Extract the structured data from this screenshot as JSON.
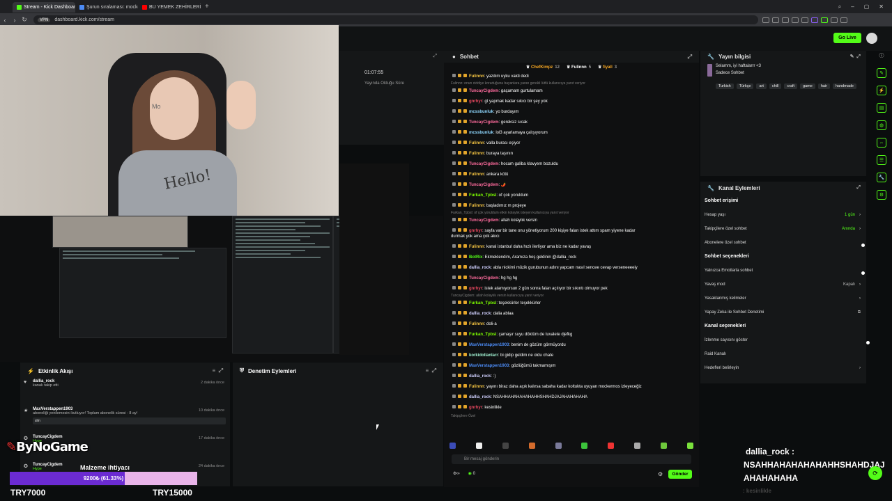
{
  "browser": {
    "tabs": [
      {
        "title": "Stream - Kick Dashboard",
        "color": "#53fc18",
        "active": true
      },
      {
        "title": "Şurun sıralaması: mocker...",
        "color": "#4c8bf5",
        "active": false
      },
      {
        "title": "BU YEMEK ZEHİRLERİ EFİ",
        "color": "#ff0000",
        "active": false
      }
    ],
    "vpn": "VPN",
    "url": "dashboard.kick.com/stream"
  },
  "header": {
    "go_live": "Go Live"
  },
  "stream_stats": {
    "time": "01:07:55",
    "label": "Yayında Olduğu Süre"
  },
  "webcam": {
    "shirt_text": "Hello!",
    "wall_text": "Mo"
  },
  "activity": {
    "title": "Etkinlik Akışı",
    "events": [
      {
        "icon": "heart-icon",
        "name": "dallia_rock",
        "sub": "kanalı takip etti",
        "when": "2 dakika önce",
        "box": ""
      },
      {
        "icon": "star-icon",
        "name": "MaxVerstappen1903",
        "sub": "aboneliği yenilemesini kutluyor! Toplam abonelik süresi - 8 ay!",
        "when": "10 dakika önce",
        "box": "slm"
      },
      {
        "icon": "gift-icon",
        "name": "TuncayCigdem",
        "sub": "Hype",
        "when": "17 dakika önce",
        "box": ""
      },
      {
        "icon": "gift-icon",
        "name": "TuncayCigdem",
        "sub": "Hype",
        "when": "24 dakika önce",
        "box": ""
      }
    ]
  },
  "moderation": {
    "title": "Denetim Eylemleri"
  },
  "chat": {
    "title": "Sohbet",
    "pinned": [
      {
        "name": "ChefKimpz",
        "count": "12",
        "color": "#f5a623"
      },
      {
        "name": "Fulinnn",
        "count": "5",
        "color": "#ffffff"
      },
      {
        "name": "fiyall",
        "count": "3",
        "color": "#f5a623"
      }
    ],
    "messages": [
      {
        "type": "msg",
        "user": "Fulinnn",
        "color": "#f5c542",
        "text": ": yazdım uyku vakti dedi"
      },
      {
        "type": "sys",
        "text": "Fulinnn: onun ciddiye koruduğuna bayanlara yaran gerekli lütfü kullanıcıya yanıt veriyor"
      },
      {
        "type": "msg",
        "user": "TuncayCigdem",
        "color": "#ff6b9d",
        "text": ": gaçamam gurtulamam"
      },
      {
        "type": "msg",
        "user": "gnrhyr",
        "color": "#e8475f",
        "text": ": gt yapmak kadar sıkıcı bir şey yok"
      },
      {
        "type": "msg",
        "user": "mcssbunluk",
        "color": "#8fd8ff",
        "text": ": yo burdayım"
      },
      {
        "type": "msg",
        "user": "TuncayCigdem",
        "color": "#ff6b9d",
        "text": ": gereksiz sıcak"
      },
      {
        "type": "msg",
        "user": "mcssbunluk",
        "color": "#8fd8ff",
        "text": ": lol3 ayarlamaya çalışıyorum"
      },
      {
        "type": "msg",
        "user": "Fulinnn",
        "color": "#f5c542",
        "text": ": valla burası eşiyor"
      },
      {
        "type": "msg",
        "user": "Fulinnn",
        "color": "#f5c542",
        "text": ": buraya taşının"
      },
      {
        "type": "msg",
        "user": "TuncayCigdem",
        "color": "#ff6b9d",
        "text": ": hocam galiba klavyem bozuldu"
      },
      {
        "type": "msg",
        "user": "Fulinnn",
        "color": "#f5c542",
        "text": ": ankara kötü"
      },
      {
        "type": "msg",
        "user": "TuncayCigdem",
        "color": "#ff6b9d",
        "text": ": 🌶️"
      },
      {
        "type": "msg",
        "user": "Furkan_Tpbsl",
        "color": "#7cfc00",
        "text": ": of çok yoruldum"
      },
      {
        "type": "msg",
        "user": "Fulinnn",
        "color": "#f5c542",
        "text": ": başladımız m projeye"
      },
      {
        "type": "sys",
        "text": "Furkan_Tpbsl: of çok yoruldum etkin kolaylık isteyen kullanıcıya yanıt veriyor"
      },
      {
        "type": "msg",
        "user": "TuncayCigdem",
        "color": "#ff6b9d",
        "text": ": allah kolaylık versin"
      },
      {
        "type": "msg2",
        "user": "gnrhyr",
        "color": "#e8475f",
        "text": ": sayfa var bir tane onu yönetiyorum 200 kişiye falan istek attım spam yiyene kadar",
        "text2": "durmak yok ama çok akıcı"
      },
      {
        "type": "msg",
        "user": "Fulinnn",
        "color": "#f5c542",
        "text": ": kanal istanbul daha hızlı ilerliyor ama biz ne kadar yavaş"
      },
      {
        "type": "msg",
        "user": "BotRix",
        "color": "#53fc18",
        "text": ": Ekmeklendim, Aramıza hoş geldinin @dallia_rock"
      },
      {
        "type": "msg",
        "user": "dallia_rock",
        "color": "#d0d0ff",
        "text": ": abla nickimi müzik gurubunun adını yapcam nasıl sencee cevap verseneeeeiy"
      },
      {
        "type": "msg",
        "user": "TuncayCigdem",
        "color": "#ff6b9d",
        "text": ": hg hg hg"
      },
      {
        "type": "msg",
        "user": "gnrhyr",
        "color": "#e8475f",
        "text": ": istek atamıyorsun 2 gün sonra falan açılıyor bir sıkıntı olmuyor pek"
      },
      {
        "type": "sys",
        "text": "TuncayCigdem: allah kolaylık versin kullanıcıya yanıt veriyor"
      },
      {
        "type": "msg",
        "user": "Furkan_Tpbsl",
        "color": "#7cfc00",
        "text": ": teşekkürler teşekkürler"
      },
      {
        "type": "msg",
        "user": "dallia_rock",
        "color": "#d0d0ff",
        "text": ": dalia ablaa"
      },
      {
        "type": "msg",
        "user": "Fulinnn",
        "color": "#f5c542",
        "text": ": doli-a"
      },
      {
        "type": "msg",
        "user": "Furkan_Tpbsl",
        "color": "#7cfc00",
        "text": ": çamaşır suyu döktüm de tuvalete djefkg"
      },
      {
        "type": "msg",
        "user": "MaxVerstappen1903",
        "color": "#4c8bf5",
        "text": ": benim de gözüm görmüyordu"
      },
      {
        "type": "msg",
        "user": "korkidollanlarr",
        "color": "#a0f0d0",
        "text": ": bi gidip geldim ne oldu chate"
      },
      {
        "type": "msg",
        "user": "MaxVerstappen1903",
        "color": "#4c8bf5",
        "text": ": gözlüğümü takmamışım"
      },
      {
        "type": "msg",
        "user": "dallia_rock",
        "color": "#d0d0ff",
        "text": ": :)"
      },
      {
        "type": "msg",
        "user": "Fulinnn",
        "color": "#f5c542",
        "text": ": yayını biraz daha açık kalırsa sabaha kadar koltukta uyuyan mockermos izleyeceğiz"
      },
      {
        "type": "msg",
        "user": "dallia_rock",
        "color": "#d0d0ff",
        "text": ": NSAHHAHAHAHAHAHHSHAHDJAJAHAHAHAHA"
      },
      {
        "type": "msg",
        "user": "gnrhyr",
        "color": "#e8475f",
        "text": ": kesinlikle"
      }
    ],
    "followers_only": "Takipçilere Özel",
    "input_placeholder": "Bir mesaj gönderin",
    "send_label": "Gönder",
    "viewer_count": "0"
  },
  "stream_info": {
    "title": "Yayın bilgisi",
    "stream_title": "Selamm, iyi haftalarrr <3",
    "category": "Sadece Sohbet",
    "tags": [
      "Turkish",
      "Türkçe",
      "art",
      "chill",
      "craft",
      "game",
      "hair",
      "handmade"
    ]
  },
  "channel_actions": {
    "title": "Kanal Eylemleri",
    "sections": [
      {
        "heading": "Sohbet erişimi",
        "rows": [
          {
            "label": "Hesap yaşı",
            "value": "1 gün",
            "control": "chevron",
            "accent": true
          },
          {
            "label": "Takipçilere özel sohbet",
            "value": "Anında",
            "control": "chevron",
            "accent": true
          },
          {
            "label": "Abonelere özel sohbet",
            "value": "",
            "control": "toggle-off"
          }
        ]
      },
      {
        "heading": "Sohbet seçenekleri",
        "rows": [
          {
            "label": "Yalnızca Emotlarla sohbet",
            "value": "",
            "control": "toggle-off"
          },
          {
            "label": "Yavaş mod",
            "value": "Kapalı",
            "control": "chevron"
          },
          {
            "label": "Yasaklanmış kelimeler",
            "value": "",
            "control": "chevron"
          },
          {
            "label": "Yapay Zeka ile Sohbet Denetimi",
            "value": "",
            "control": "external"
          }
        ]
      },
      {
        "heading": "Kanal seçenekleri",
        "rows": [
          {
            "label": "İzlenme sayısını göster",
            "value": "",
            "control": "toggle-on"
          },
          {
            "label": "Raid Kanalı",
            "value": "",
            "control": "none"
          },
          {
            "label": "Hedefleri belirleyin",
            "value": "",
            "control": "chevron"
          }
        ]
      }
    ]
  },
  "overlay": {
    "brand": "ByNoGame",
    "goal_label": "Malzeme ihtiyacı",
    "goal_text": "9200₺ (61.33%)",
    "goal_fraction": 0.6133,
    "goal_min": "TRY7000",
    "goal_max": "TRY15000",
    "alert_user": "dallia_rock :",
    "alert_text": "NSAHHAHAHAHAHAHHSHAHDJAJAHAHAHAHA",
    "alert_tail": ": kesinlikle"
  },
  "colors": {
    "accent": "#53fc18",
    "goal_fill": "#6b2bd2",
    "goal_bg": "#e9b4e9"
  }
}
